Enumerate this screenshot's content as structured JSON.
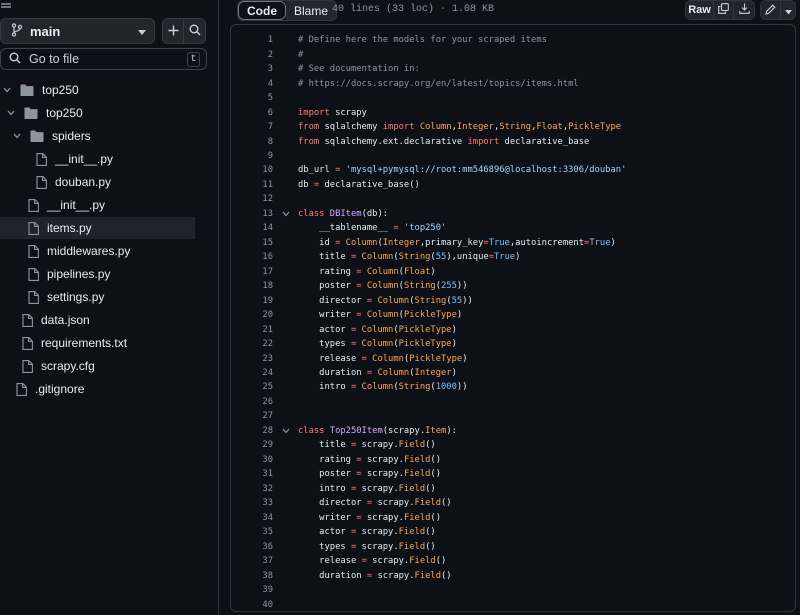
{
  "branch": {
    "name": "main"
  },
  "search": {
    "placeholder": "Go to file",
    "shortcut": "t"
  },
  "tree": [
    {
      "name": "top250",
      "type": "folder",
      "open": true
    },
    {
      "name": "top250",
      "type": "folder",
      "open": true
    },
    {
      "name": "spiders",
      "type": "folder",
      "open": true
    },
    {
      "name": "__init__.py",
      "type": "file"
    },
    {
      "name": "douban.py",
      "type": "file"
    },
    {
      "name": "__init__.py",
      "type": "file"
    },
    {
      "name": "items.py",
      "type": "file",
      "selected": true
    },
    {
      "name": "middlewares.py",
      "type": "file"
    },
    {
      "name": "pipelines.py",
      "type": "file"
    },
    {
      "name": "settings.py",
      "type": "file"
    },
    {
      "name": "data.json",
      "type": "file"
    },
    {
      "name": "requirements.txt",
      "type": "file"
    },
    {
      "name": "scrapy.cfg",
      "type": "file"
    },
    {
      "name": ".gitignore",
      "type": "file"
    }
  ],
  "toolbar": {
    "code_tab": "Code",
    "blame_tab": "Blame",
    "file_meta": "40 lines (33 loc) · 1.08 KB",
    "raw_label": "Raw"
  },
  "code": [
    [
      [
        "c-com",
        "# Define here the models for your scraped items"
      ]
    ],
    [
      [
        "c-com",
        "#"
      ]
    ],
    [
      [
        "c-com",
        "# See documentation in:"
      ]
    ],
    [
      [
        "c-com",
        "# https://docs.scrapy.org/en/latest/topics/items.html"
      ]
    ],
    [],
    [
      [
        "c-kw",
        "import"
      ],
      [
        "c-pl",
        " scrapy"
      ]
    ],
    [
      [
        "c-kw",
        "from"
      ],
      [
        "c-pl",
        " sqlalchemy "
      ],
      [
        "c-kw",
        "import"
      ],
      [
        "c-fn",
        " Column"
      ],
      [
        "c-pl",
        ","
      ],
      [
        "c-fn",
        "Integer"
      ],
      [
        "c-pl",
        ","
      ],
      [
        "c-fn",
        "String"
      ],
      [
        "c-pl",
        ","
      ],
      [
        "c-fn",
        "Float"
      ],
      [
        "c-pl",
        ","
      ],
      [
        "c-fn",
        "PickleType"
      ]
    ],
    [
      [
        "c-kw",
        "from"
      ],
      [
        "c-pl",
        " sqlalchemy.ext.declarative "
      ],
      [
        "c-kw",
        "import"
      ],
      [
        "c-pl",
        " declarative_base"
      ]
    ],
    [],
    [
      [
        "c-pl",
        "db_url "
      ],
      [
        "c-kw",
        "="
      ],
      [
        "c-str",
        " 'mysql+pymysql://root:mm546896@localhost:3306/douban'"
      ]
    ],
    [
      [
        "c-pl",
        "db "
      ],
      [
        "c-kw",
        "="
      ],
      [
        "c-pl",
        " declarative_base()"
      ]
    ],
    [],
    [
      [
        "c-kw",
        "class"
      ],
      [
        "c-cls",
        " DBItem"
      ],
      [
        "c-pl",
        "(db):"
      ]
    ],
    [
      [
        "c-pl",
        "    __tablename__ "
      ],
      [
        "c-kw",
        "="
      ],
      [
        "c-str",
        " 'top250'"
      ]
    ],
    [
      [
        "c-pl",
        "    id "
      ],
      [
        "c-kw",
        "="
      ],
      [
        "c-fn",
        " Column"
      ],
      [
        "c-pl",
        "("
      ],
      [
        "c-fn",
        "Integer"
      ],
      [
        "c-pl",
        ",primary_key"
      ],
      [
        "c-kw",
        "="
      ],
      [
        "c-num",
        "True"
      ],
      [
        "c-pl",
        ",autoincrement"
      ],
      [
        "c-kw",
        "="
      ],
      [
        "c-num",
        "True"
      ],
      [
        "c-pl",
        ")"
      ]
    ],
    [
      [
        "c-pl",
        "    title "
      ],
      [
        "c-kw",
        "="
      ],
      [
        "c-fn",
        " Column"
      ],
      [
        "c-pl",
        "("
      ],
      [
        "c-fn",
        "String"
      ],
      [
        "c-pl",
        "("
      ],
      [
        "c-num",
        "55"
      ],
      [
        "c-pl",
        "),unique"
      ],
      [
        "c-kw",
        "="
      ],
      [
        "c-num",
        "True"
      ],
      [
        "c-pl",
        ")"
      ]
    ],
    [
      [
        "c-pl",
        "    rating "
      ],
      [
        "c-kw",
        "="
      ],
      [
        "c-fn",
        " Column"
      ],
      [
        "c-pl",
        "("
      ],
      [
        "c-fn",
        "Float"
      ],
      [
        "c-pl",
        ")"
      ]
    ],
    [
      [
        "c-pl",
        "    poster "
      ],
      [
        "c-kw",
        "="
      ],
      [
        "c-fn",
        " Column"
      ],
      [
        "c-pl",
        "("
      ],
      [
        "c-fn",
        "String"
      ],
      [
        "c-pl",
        "("
      ],
      [
        "c-num",
        "255"
      ],
      [
        "c-pl",
        "))"
      ]
    ],
    [
      [
        "c-pl",
        "    director "
      ],
      [
        "c-kw",
        "="
      ],
      [
        "c-fn",
        " Column"
      ],
      [
        "c-pl",
        "("
      ],
      [
        "c-fn",
        "String"
      ],
      [
        "c-pl",
        "("
      ],
      [
        "c-num",
        "55"
      ],
      [
        "c-pl",
        "))"
      ]
    ],
    [
      [
        "c-pl",
        "    writer "
      ],
      [
        "c-kw",
        "="
      ],
      [
        "c-fn",
        " Column"
      ],
      [
        "c-pl",
        "("
      ],
      [
        "c-fn",
        "PickleType"
      ],
      [
        "c-pl",
        ")"
      ]
    ],
    [
      [
        "c-pl",
        "    actor "
      ],
      [
        "c-kw",
        "="
      ],
      [
        "c-fn",
        " Column"
      ],
      [
        "c-pl",
        "("
      ],
      [
        "c-fn",
        "PickleType"
      ],
      [
        "c-pl",
        ")"
      ]
    ],
    [
      [
        "c-pl",
        "    types "
      ],
      [
        "c-kw",
        "="
      ],
      [
        "c-fn",
        " Column"
      ],
      [
        "c-pl",
        "("
      ],
      [
        "c-fn",
        "PickleType"
      ],
      [
        "c-pl",
        ")"
      ]
    ],
    [
      [
        "c-pl",
        "    release "
      ],
      [
        "c-kw",
        "="
      ],
      [
        "c-fn",
        " Column"
      ],
      [
        "c-pl",
        "("
      ],
      [
        "c-fn",
        "PickleType"
      ],
      [
        "c-pl",
        ")"
      ]
    ],
    [
      [
        "c-pl",
        "    duration "
      ],
      [
        "c-kw",
        "="
      ],
      [
        "c-fn",
        " Column"
      ],
      [
        "c-pl",
        "("
      ],
      [
        "c-fn",
        "Integer"
      ],
      [
        "c-pl",
        ")"
      ]
    ],
    [
      [
        "c-pl",
        "    intro "
      ],
      [
        "c-kw",
        "="
      ],
      [
        "c-fn",
        " Column"
      ],
      [
        "c-pl",
        "("
      ],
      [
        "c-fn",
        "String"
      ],
      [
        "c-pl",
        "("
      ],
      [
        "c-num",
        "1000"
      ],
      [
        "c-pl",
        "))"
      ]
    ],
    [],
    [],
    [
      [
        "c-kw",
        "class"
      ],
      [
        "c-cls",
        " Top250Item"
      ],
      [
        "c-pl",
        "(scrapy."
      ],
      [
        "c-fn",
        "Item"
      ],
      [
        "c-pl",
        "):"
      ]
    ],
    [
      [
        "c-pl",
        "    title "
      ],
      [
        "c-kw",
        "="
      ],
      [
        "c-pl",
        " scrapy."
      ],
      [
        "c-fn",
        "Field"
      ],
      [
        "c-pl",
        "()"
      ]
    ],
    [
      [
        "c-pl",
        "    rating "
      ],
      [
        "c-kw",
        "="
      ],
      [
        "c-pl",
        " scrapy."
      ],
      [
        "c-fn",
        "Field"
      ],
      [
        "c-pl",
        "()"
      ]
    ],
    [
      [
        "c-pl",
        "    poster "
      ],
      [
        "c-kw",
        "="
      ],
      [
        "c-pl",
        " scrapy."
      ],
      [
        "c-fn",
        "Field"
      ],
      [
        "c-pl",
        "()"
      ]
    ],
    [
      [
        "c-pl",
        "    intro "
      ],
      [
        "c-kw",
        "="
      ],
      [
        "c-pl",
        " scrapy."
      ],
      [
        "c-fn",
        "Field"
      ],
      [
        "c-pl",
        "()"
      ]
    ],
    [
      [
        "c-pl",
        "    director "
      ],
      [
        "c-kw",
        "="
      ],
      [
        "c-pl",
        " scrapy."
      ],
      [
        "c-fn",
        "Field"
      ],
      [
        "c-pl",
        "()"
      ]
    ],
    [
      [
        "c-pl",
        "    writer "
      ],
      [
        "c-kw",
        "="
      ],
      [
        "c-pl",
        " scrapy."
      ],
      [
        "c-fn",
        "Field"
      ],
      [
        "c-pl",
        "()"
      ]
    ],
    [
      [
        "c-pl",
        "    actor "
      ],
      [
        "c-kw",
        "="
      ],
      [
        "c-pl",
        " scrapy."
      ],
      [
        "c-fn",
        "Field"
      ],
      [
        "c-pl",
        "()"
      ]
    ],
    [
      [
        "c-pl",
        "    types "
      ],
      [
        "c-kw",
        "="
      ],
      [
        "c-pl",
        " scrapy."
      ],
      [
        "c-fn",
        "Field"
      ],
      [
        "c-pl",
        "()"
      ]
    ],
    [
      [
        "c-pl",
        "    release "
      ],
      [
        "c-kw",
        "="
      ],
      [
        "c-pl",
        " scrapy."
      ],
      [
        "c-fn",
        "Field"
      ],
      [
        "c-pl",
        "()"
      ]
    ],
    [
      [
        "c-pl",
        "    duration "
      ],
      [
        "c-kw",
        "="
      ],
      [
        "c-pl",
        " scrapy."
      ],
      [
        "c-fn",
        "Field"
      ],
      [
        "c-pl",
        "()"
      ]
    ],
    [],
    []
  ],
  "fold_lines": [
    13,
    28
  ]
}
